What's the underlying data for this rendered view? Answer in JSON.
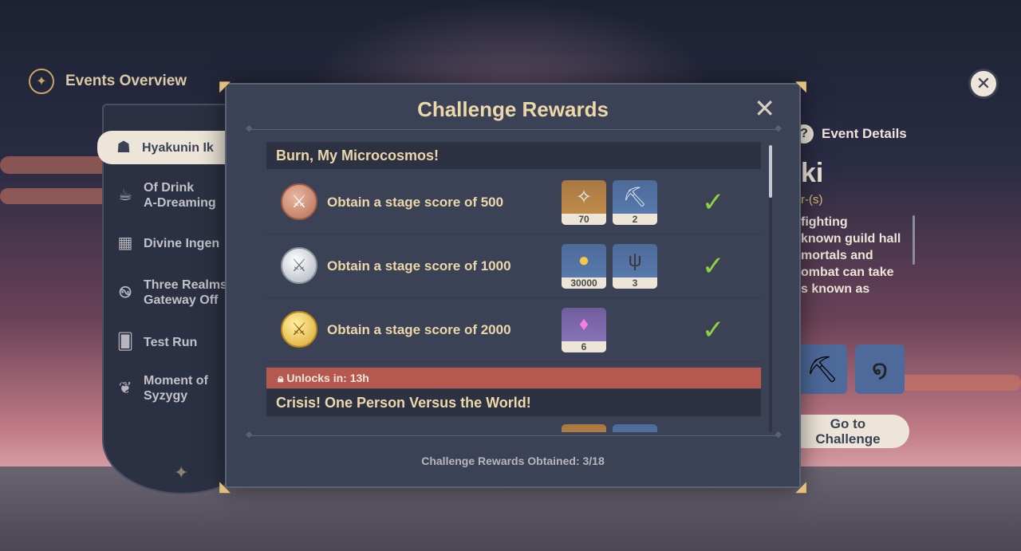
{
  "header": {
    "title": "Events Overview",
    "icon": "compass-icon"
  },
  "sidebar": {
    "items": [
      {
        "label": "Hyakunin Ik",
        "icon": "mask-icon",
        "active": true
      },
      {
        "label": "Of Drink\nA-Dreaming",
        "icon": "teacup-icon"
      },
      {
        "label": "Divine Ingen",
        "icon": "blocks-icon"
      },
      {
        "label": "Three Realms\nGateway Off",
        "icon": "spiral-icon"
      },
      {
        "label": "Test Run",
        "icon": "cards-icon"
      },
      {
        "label": "Moment of\nSyzygy",
        "icon": "tree-icon"
      }
    ]
  },
  "right_panel": {
    "details_label": "Event Details",
    "name_fragment": "ki",
    "sub_fragment": "r-(s)",
    "description": "fighting\nknown guild hall\nmortals and\nombat can take\ns known as",
    "go_button": "Go to\nChallenge"
  },
  "modal": {
    "title": "Challenge Rewards",
    "sections": [
      {
        "title": "Burn, My Microcosmos!",
        "rows": [
          {
            "medal": "bronze",
            "text": "Obtain a stage score of 500",
            "rewards": [
              {
                "icon": "primogem-icon",
                "qty": "70",
                "rarity": "orange"
              },
              {
                "icon": "ore-icon",
                "qty": "2",
                "rarity": "blue"
              }
            ],
            "completed": true
          },
          {
            "medal": "silver",
            "text": "Obtain a stage score of 1000",
            "rewards": [
              {
                "icon": "mora-icon",
                "qty": "30000",
                "rarity": "blue"
              },
              {
                "icon": "coral-icon",
                "qty": "3",
                "rarity": "blue"
              }
            ],
            "completed": true
          },
          {
            "medal": "gold",
            "text": "Obtain a stage score of 2000",
            "rewards": [
              {
                "icon": "crystal-icon",
                "qty": "6",
                "rarity": "purple"
              }
            ],
            "completed": true
          }
        ]
      },
      {
        "title": "Crisis! One Person Versus the World!",
        "locked_text": "Unlocks in: 13h"
      }
    ],
    "obtained_text": "Challenge Rewards Obtained: 3/18"
  },
  "colors": {
    "panel": "#3b4255",
    "accent_gold": "#ecd7a9",
    "check_green": "#8fd13c",
    "lock_red": "#b5584f"
  }
}
